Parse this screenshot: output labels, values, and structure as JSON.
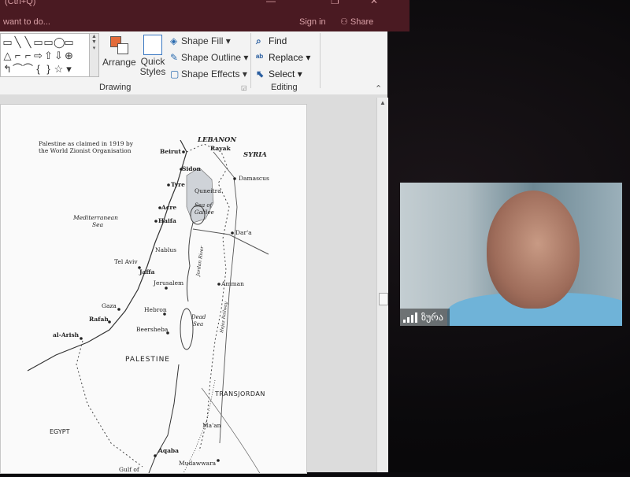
{
  "window": {
    "app_title": "(Ctrl+Q)",
    "doc_hint": "want to do...",
    "controls": [
      "—",
      "❐",
      "✕"
    ],
    "sign_in": "Sign in",
    "share": "Share"
  },
  "ribbon": {
    "shapes_gallery": [
      "▭",
      "╲",
      "╲",
      "▭",
      "▭",
      "◯",
      "▭",
      "△",
      "⌐",
      "⌐",
      "⇨",
      "⇧",
      "⇩",
      "⊕",
      "↰",
      "⌒",
      "⌒",
      "{",
      "}",
      "☆",
      "▾"
    ],
    "arrange": "Arrange",
    "quick_styles_line1": "Quick",
    "quick_styles_line2": "Styles",
    "shape_fill": "Shape Fill",
    "shape_outline": "Shape Outline",
    "shape_effects": "Shape Effects",
    "drawing_group": "Drawing",
    "find": "Find",
    "replace": "Replace",
    "select": "Select",
    "editing_group": "Editing"
  },
  "map": {
    "caption_line1": "Palestine as claimed in 1919 by",
    "caption_line2": "the World Zionist Organisation",
    "lebanon": "LEBANON",
    "syria": "SYRIA",
    "beirut": "Beirut",
    "rayak": "Rayak",
    "sidon": "Sidon",
    "damascus": "Damascus",
    "tyre": "Tyre",
    "quneitra": "Quneitra",
    "acre": "Acre",
    "sea_of_galilee_1": "Sea of",
    "sea_of_galilee_2": "Galilee",
    "haifa": "Haifa",
    "deraa": "Dar'a",
    "med_sea_1": "Mediterranean",
    "med_sea_2": "Sea",
    "nablus": "Nablus",
    "jordan_river": "Jordan River",
    "tel_aviv": "Tel Aviv",
    "jaffa": "Jaffa",
    "jerusalem": "Jerusalem",
    "amman": "Amman",
    "gaza": "Gaza",
    "hebron": "Hebron",
    "rafah": "Rafah",
    "dead_sea_1": "Dead",
    "dead_sea_2": "Sea",
    "beersheba": "Beersheba",
    "al_arish": "al-Arish",
    "hejaz_railway": "Hejaz Railway",
    "palestine": "PALESTINE",
    "transjordan": "TRANSJORDAN",
    "egypt": "EGYPT",
    "maan": "Ma'an",
    "aqaba": "Aqaba",
    "mudawwara": "Mudawwara",
    "gulf_of": "Gulf of"
  },
  "video": {
    "participant_name": "ზურა"
  },
  "colors": {
    "title_bar": "#4a1a22",
    "ribbon": "#f3f3f3",
    "icon_blue": "#2b6cb0",
    "shirt": "#6fb3d8"
  }
}
